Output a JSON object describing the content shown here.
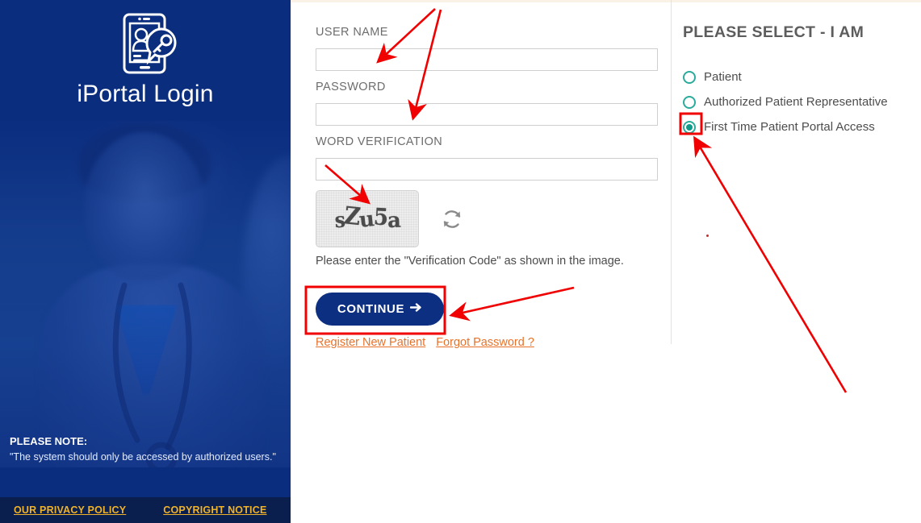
{
  "brand": {
    "title": "iPortal Login",
    "logo_icon": "tablet-user-key-icon",
    "panel_color": "#0b2d7e",
    "footer_color": "#0a1f4d",
    "accent_orange": "#e8722a",
    "accent_gold": "#f0b228",
    "accent_teal": "#2aab9b",
    "annotation_color": "#f00000"
  },
  "left_panel": {
    "note_title": "PLEASE NOTE:",
    "note_text": "\"The system should only be accessed by authorized users.\"",
    "footer_links": [
      {
        "label": "OUR PRIVACY POLICY"
      },
      {
        "label": "COPYRIGHT NOTICE"
      }
    ]
  },
  "form": {
    "username": {
      "label": "USER NAME",
      "value": "",
      "placeholder": ""
    },
    "password": {
      "label": "PASSWORD",
      "value": "",
      "placeholder": ""
    },
    "word_verification": {
      "label": "WORD VERIFICATION",
      "value": "",
      "placeholder": ""
    },
    "captcha": {
      "text": "sZu5a",
      "chars": [
        "s",
        "Z",
        "u",
        "5",
        "a"
      ],
      "refresh_icon": "refresh-circular-arrow-icon"
    },
    "hint": "Please enter the \"Verification Code\" as shown in the image.",
    "continue_button": {
      "label": "CONTINUE",
      "icon": "arrow-right-icon"
    },
    "links": [
      {
        "label": "Register New Patient"
      },
      {
        "label": "Forgot Password ?"
      }
    ]
  },
  "select_panel": {
    "title": "PLEASE SELECT - I AM",
    "options": [
      {
        "label": "Patient",
        "selected": false
      },
      {
        "label": "Authorized Patient Representative",
        "selected": false
      },
      {
        "label": "First Time Patient Portal Access",
        "selected": true
      }
    ]
  },
  "annotations": {
    "highlight_boxes": [
      {
        "name": "continue-button-highlight"
      },
      {
        "name": "first-time-radio-highlight"
      }
    ],
    "arrows": [
      {
        "name": "arrow-to-username-field"
      },
      {
        "name": "arrow-to-password-field"
      },
      {
        "name": "arrow-to-captcha-image"
      },
      {
        "name": "arrow-to-continue-button"
      },
      {
        "name": "arrow-to-first-time-radio"
      }
    ]
  }
}
